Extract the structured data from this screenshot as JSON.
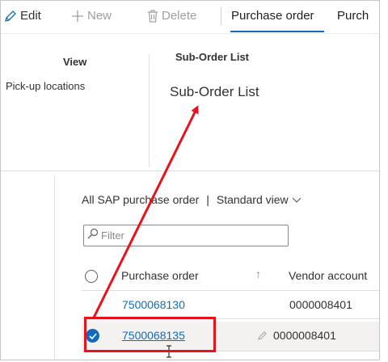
{
  "toolbar": {
    "edit_label": "Edit",
    "new_label": "New",
    "delete_label": "Delete",
    "tab_purchase_order": "Purchase order",
    "tab_truncated": "Purch"
  },
  "ribbon": {
    "view_group_header": "View",
    "pickup_locations_label": "Pick-up locations",
    "suborder_group_header": "Sub-Order List",
    "suborder_list_label": "Sub-Order List"
  },
  "grid": {
    "view_title": "All SAP purchase order",
    "view_separator": "|",
    "view_name": "Standard view",
    "filter_placeholder": "Filter",
    "columns": {
      "purchase_order": "Purchase order",
      "sort_indicator": "↑",
      "vendor_account": "Vendor account"
    },
    "rows": [
      {
        "purchase_order": "7500068130",
        "vendor_account": "0000008401",
        "selected": false
      },
      {
        "purchase_order": "7500068135",
        "vendor_account": "0000008401",
        "selected": true
      }
    ]
  },
  "annotation": {
    "highlight_color": "#e8111c"
  },
  "colors": {
    "accent": "#0f6cbd",
    "text": "#323130",
    "disabled": "#a19f9d"
  }
}
